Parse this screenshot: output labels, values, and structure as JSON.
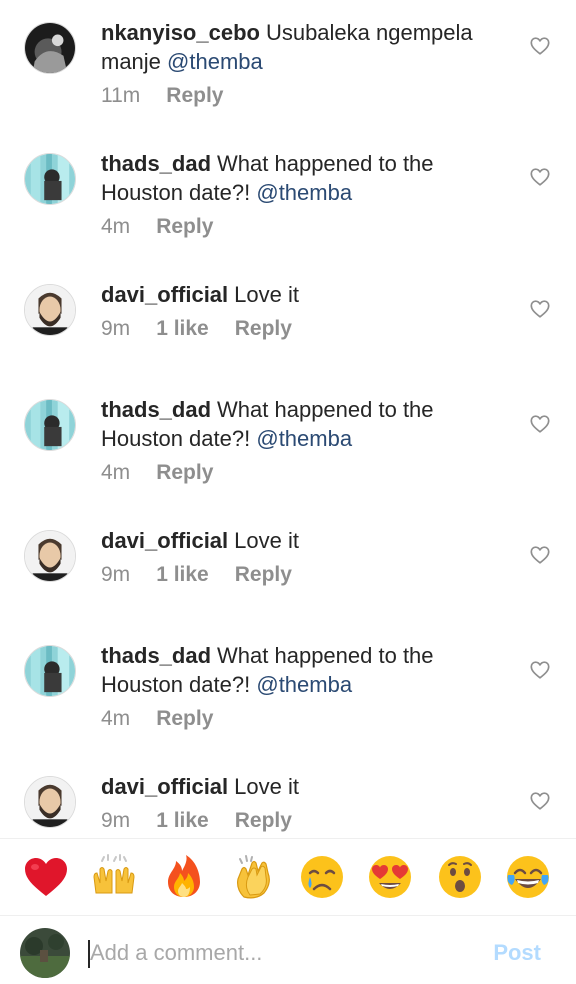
{
  "comments": [
    {
      "username": "nkanyiso_cebo",
      "text": "Usubaleka ngempela manje",
      "mention": "@themba",
      "time": "11m",
      "likes": "",
      "reply": "Reply",
      "avatar": "avatar-dark-photo"
    },
    {
      "username": "thads_dad",
      "text": "What happened to the Houston date?!",
      "mention": "@themba",
      "time": "4m",
      "likes": "",
      "reply": "Reply",
      "avatar": "avatar-teal-photo"
    },
    {
      "username": "davi_official",
      "text": "Love it",
      "mention": "",
      "time": "9m",
      "likes": "1 like",
      "reply": "Reply",
      "avatar": "avatar-bearded-man"
    },
    {
      "username": "thads_dad",
      "text": "What happened to the Houston date?!",
      "mention": "@themba",
      "time": "4m",
      "likes": "",
      "reply": "Reply",
      "avatar": "avatar-teal-photo"
    },
    {
      "username": "davi_official",
      "text": "Love it",
      "mention": "",
      "time": "9m",
      "likes": "1 like",
      "reply": "Reply",
      "avatar": "avatar-bearded-man"
    },
    {
      "username": "thads_dad",
      "text": "What happened to the Houston date?!",
      "mention": "@themba",
      "time": "4m",
      "likes": "",
      "reply": "Reply",
      "avatar": "avatar-teal-photo"
    },
    {
      "username": "davi_official",
      "text": "Love it",
      "mention": "",
      "time": "9m",
      "likes": "1 like",
      "reply": "Reply",
      "avatar": "avatar-bearded-man"
    }
  ],
  "emoji_bar": [
    "red-heart",
    "raising-hands",
    "fire",
    "clapping-hands",
    "crying-face",
    "heart-eyes-face",
    "astonished-face",
    "tears-of-joy-face"
  ],
  "composer": {
    "placeholder": "Add a comment...",
    "post_label": "Post"
  },
  "colors": {
    "mention": "#2b4a73",
    "meta": "#8e8e8e",
    "post_disabled": "#b3dbff"
  }
}
